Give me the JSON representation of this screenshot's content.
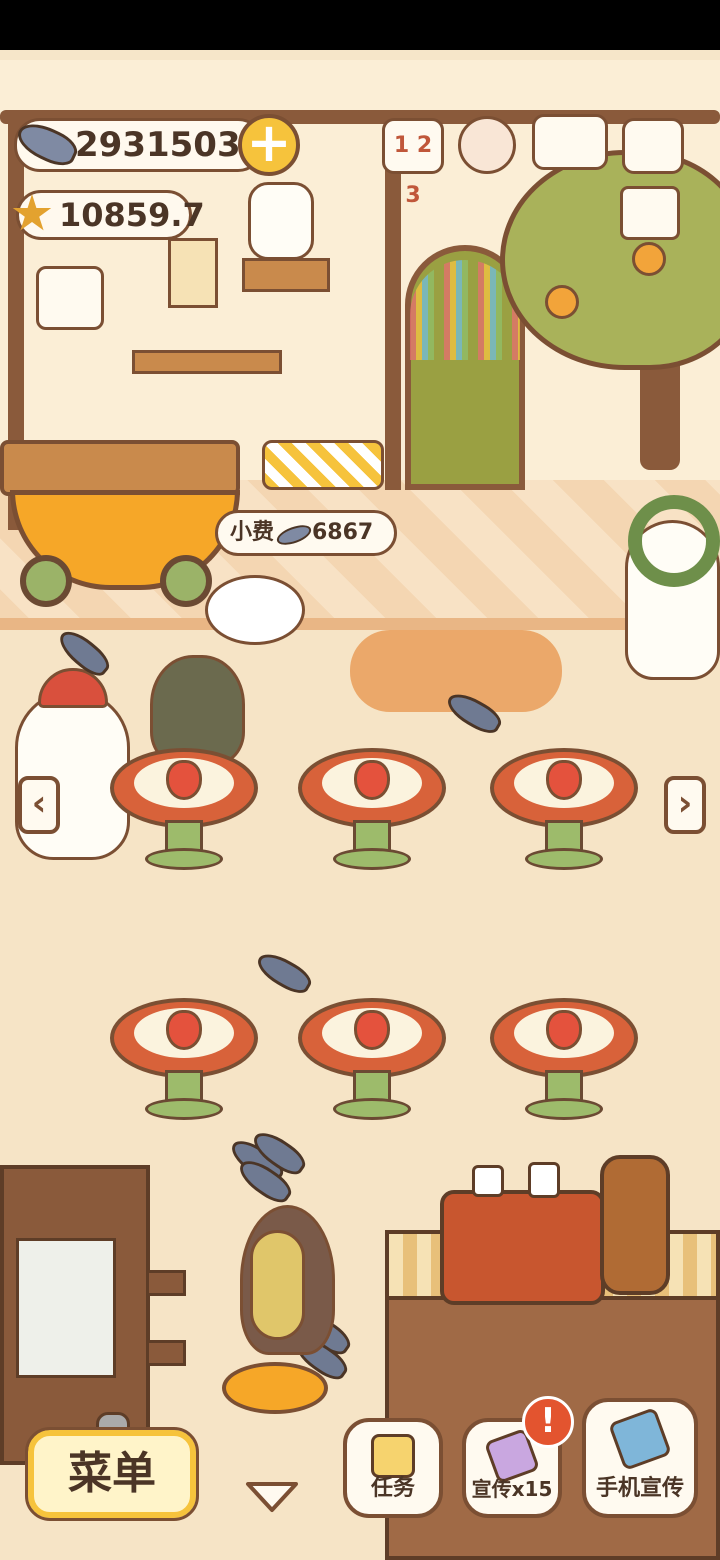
{
  "hud": {
    "fish_currency": "2931503",
    "star_rating": "10859.7",
    "add_currency_label": "+"
  },
  "top_icons": {
    "ranking": "1 2 3",
    "settings": "",
    "recipe_book": "",
    "camera": ""
  },
  "scene": {
    "tip_label": "小费",
    "tip_value": "6867"
  },
  "bottom_bar": {
    "menu_label": "菜单",
    "tasks_label": "任务",
    "promote_label": "宣传x15",
    "alert_mark": "!",
    "phone_promote_label": "手机宣传"
  },
  "colors": {
    "wood": "#7b4f33",
    "table_top": "#d8623a",
    "table_leg": "#9dbb6b",
    "accent_yellow": "#f6c33c",
    "floor": "#f6e4c6"
  }
}
